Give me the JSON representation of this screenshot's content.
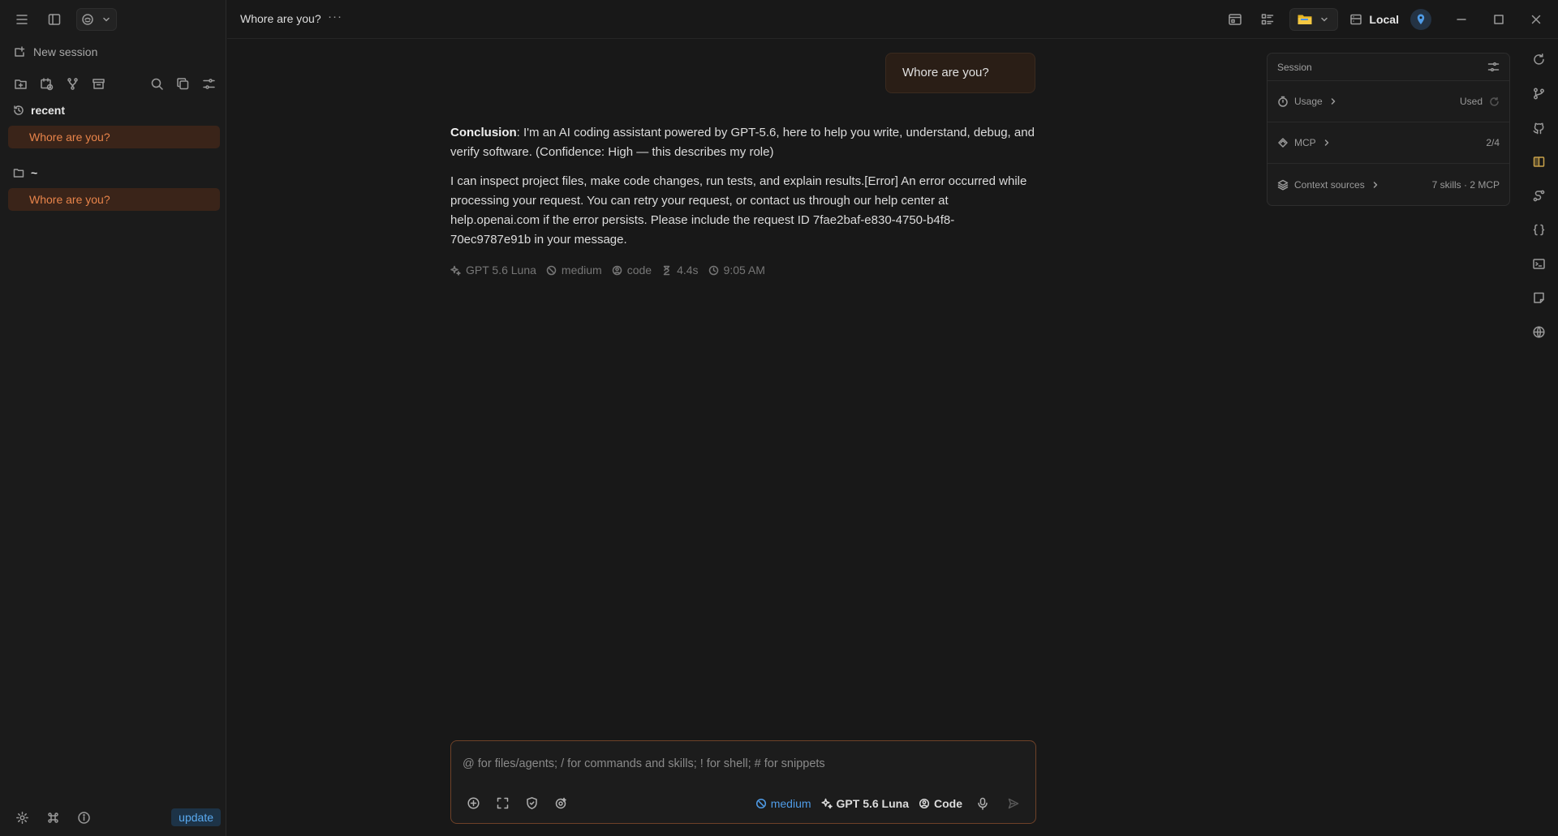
{
  "sidebar": {
    "new_session": "New session",
    "groups": [
      {
        "title": "recent",
        "item": "Whore are you?"
      },
      {
        "title": "~",
        "item": "Whore are you?"
      }
    ],
    "update_label": "update"
  },
  "titlebar": {
    "title": "Whore are you?",
    "more": "···",
    "env_label": "Local"
  },
  "chat": {
    "user_message": "Whore are you?",
    "answer": {
      "conclusion_label": "Conclusion",
      "conclusion_text": ": I'm an AI coding assistant powered by GPT-5.6, here to help you write, understand, debug, and verify software. (Confidence: High — this describes my role)",
      "body": "I can inspect project files, make code changes, run tests, and explain results.[Error] An error occurred while processing your request. You can retry your request, or contact us through our help center at help.openai.com if the error persists. Please include the request ID 7fae2baf-e830-4750-b4f8-70ec9787e91b in your message."
    },
    "meta": {
      "model": "GPT 5.6 Luna",
      "effort": "medium",
      "mode": "code",
      "duration": "4.4s",
      "time": "9:05 AM"
    }
  },
  "session_panel": {
    "title": "Session",
    "rows": [
      {
        "label": "Usage",
        "value": "Used"
      },
      {
        "label": "MCP",
        "value": "2/4"
      },
      {
        "label": "Context sources",
        "value": "7 skills · 2 MCP"
      }
    ]
  },
  "composer": {
    "placeholder": "@ for files/agents; / for commands and skills; ! for shell; # for snippets",
    "effort": "medium",
    "model": "GPT 5.6 Luna",
    "mode": "Code"
  },
  "colors": {
    "accent": "#e8844a",
    "accent_bg": "#3a2419",
    "link_blue": "#4f9be6",
    "background": "#181818"
  }
}
